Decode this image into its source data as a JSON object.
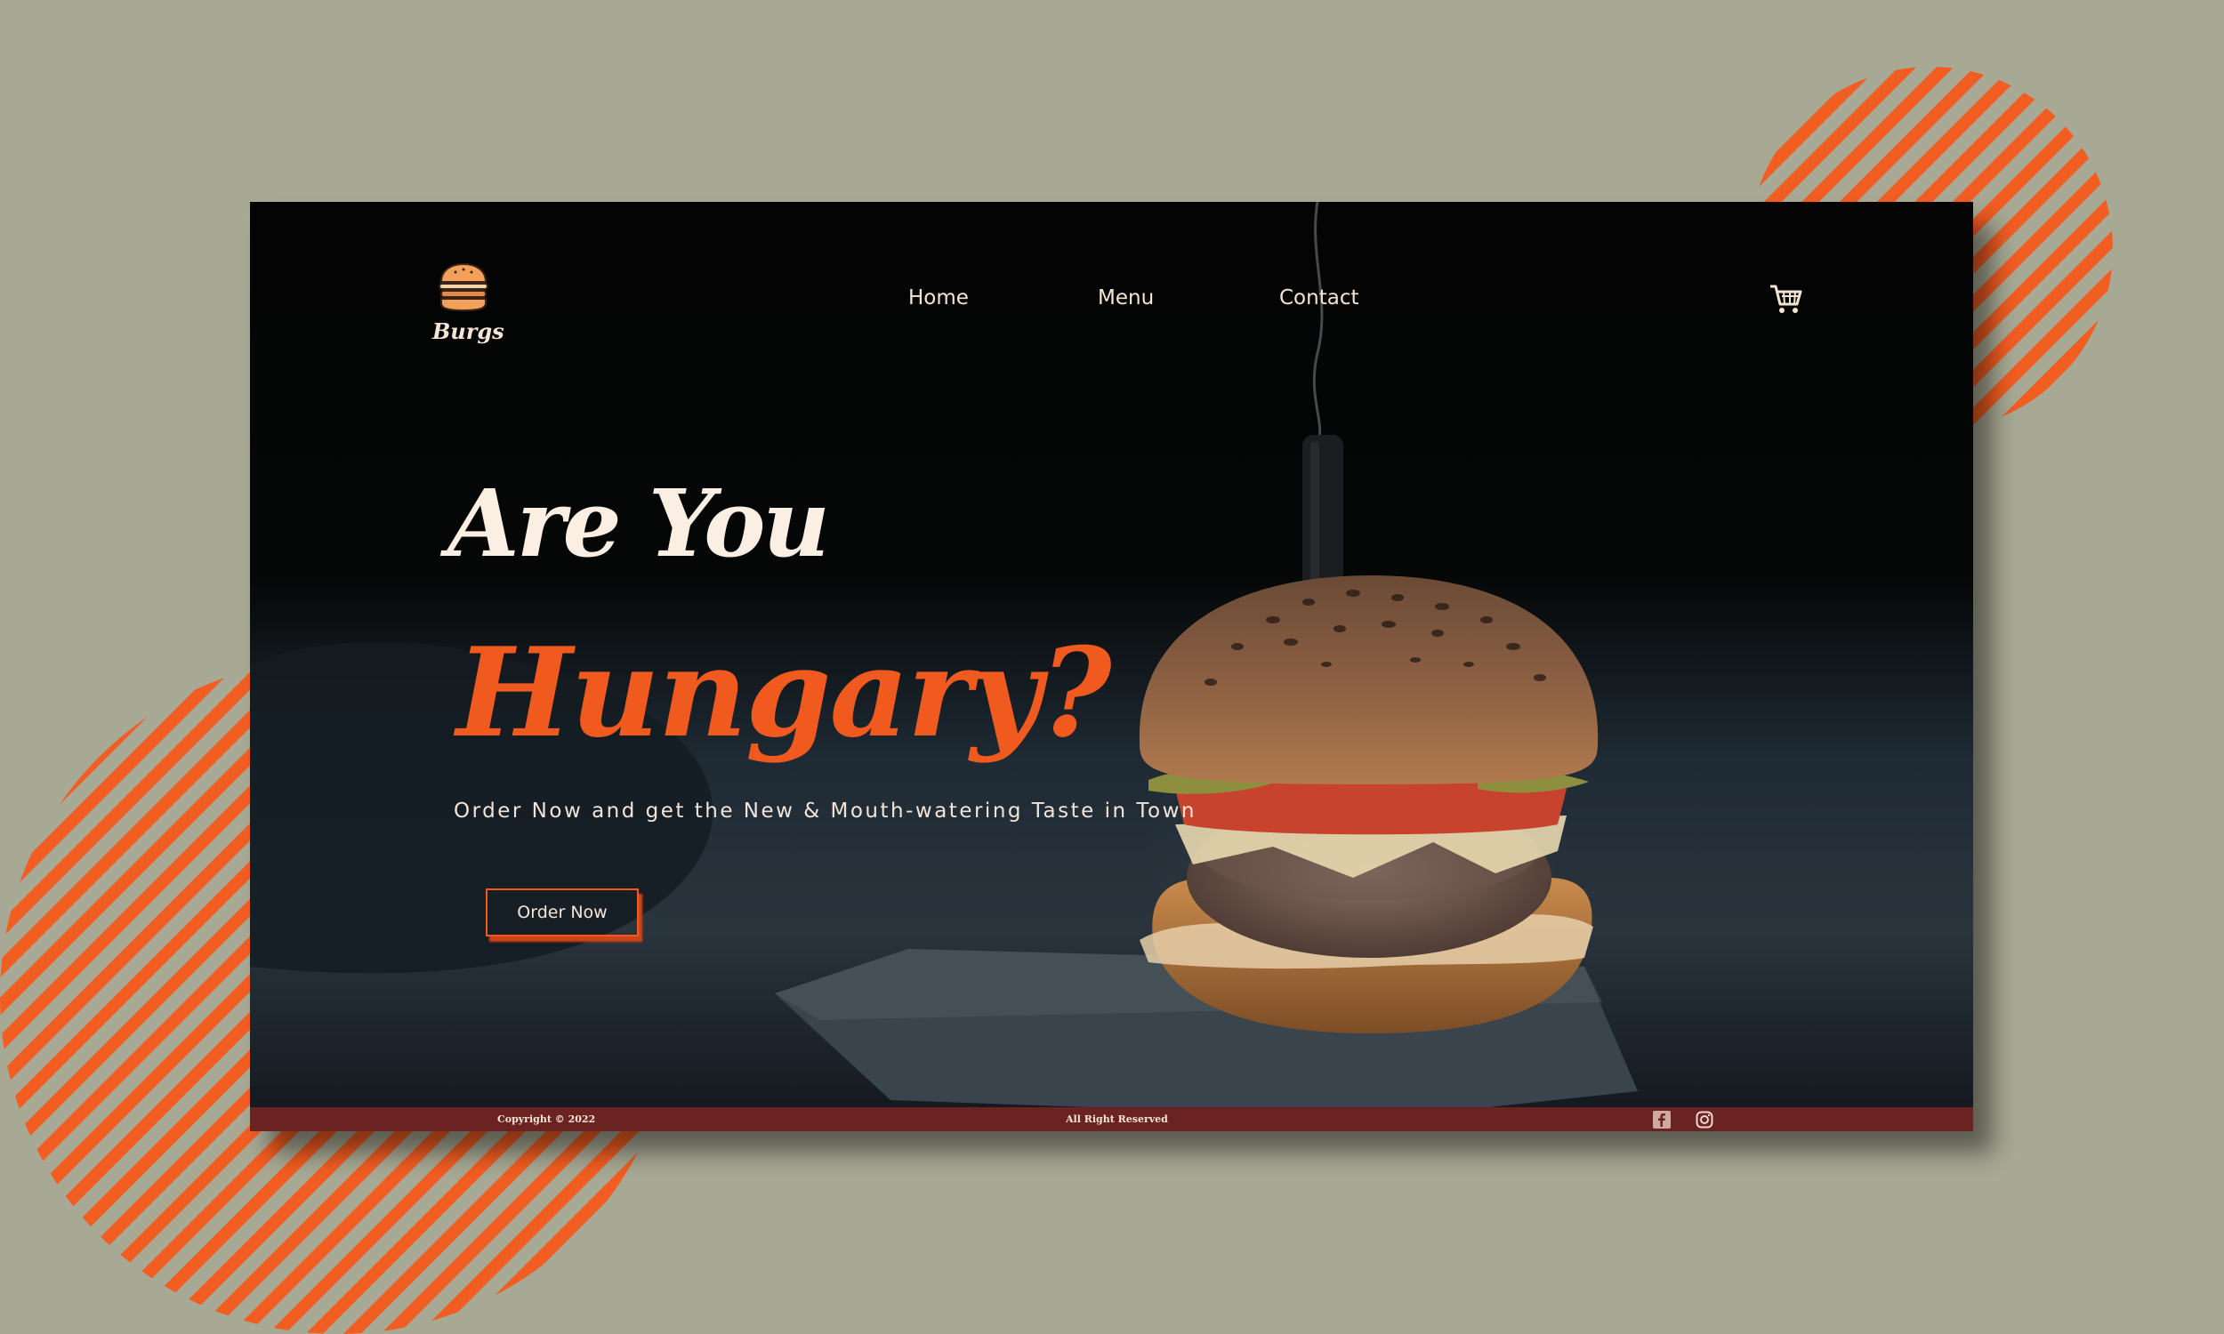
{
  "brand": {
    "name": "Burgs"
  },
  "nav": {
    "home": "Home",
    "menu": "Menu",
    "contact": "Contact"
  },
  "hero": {
    "title_line1": "Are You",
    "title_line2": "Hungary?",
    "subtitle": "Order Now and get the New & Mouth-watering Taste in Town",
    "cta_label": "Order Now"
  },
  "footer": {
    "copyright": "Copyright © 2022",
    "rights": "All Right Reserved"
  },
  "icons": {
    "logo": "burger-icon",
    "cart": "cart-icon",
    "social": [
      "facebook-icon",
      "instagram-icon"
    ]
  },
  "colors": {
    "background": "#a8a994",
    "accent": "#f05a1f",
    "cream": "#fbeee2",
    "footer": "#6b2322"
  }
}
